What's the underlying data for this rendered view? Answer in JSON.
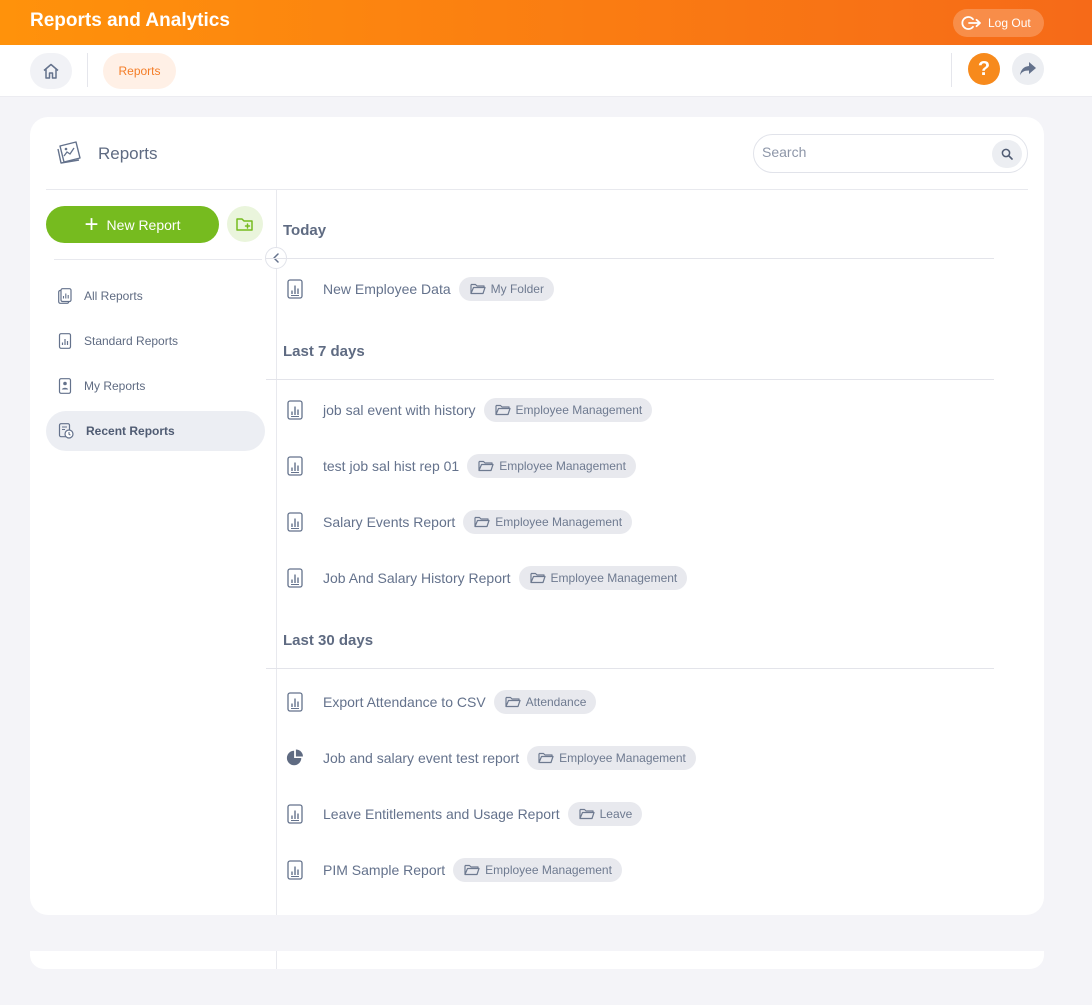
{
  "header": {
    "title": "Reports and Analytics",
    "logout_label": "Log Out"
  },
  "subnav": {
    "breadcrumb": "Reports"
  },
  "card": {
    "title": "Reports",
    "search_placeholder": "Search"
  },
  "sidebar": {
    "new_report_label": "New Report",
    "items": [
      {
        "label": "All Reports",
        "icon": "all-reports-icon"
      },
      {
        "label": "Standard Reports",
        "icon": "standard-reports-icon"
      },
      {
        "label": "My Reports",
        "icon": "my-reports-icon"
      },
      {
        "label": "Recent Reports",
        "icon": "recent-reports-icon",
        "active": true
      }
    ]
  },
  "sections": [
    {
      "title": "Today",
      "reports": [
        {
          "name": "New Employee Data",
          "folder": "My Folder",
          "icon": "report-icon"
        }
      ]
    },
    {
      "title": "Last 7 days",
      "reports": [
        {
          "name": "job sal event with history",
          "folder": "Employee Management",
          "icon": "report-icon"
        },
        {
          "name": "test job sal hist rep 01",
          "folder": "Employee Management",
          "icon": "report-icon"
        },
        {
          "name": "Salary Events Report",
          "folder": "Employee Management",
          "icon": "report-icon"
        },
        {
          "name": "Job And Salary History Report",
          "folder": "Employee Management",
          "icon": "report-icon"
        }
      ]
    },
    {
      "title": "Last 30 days",
      "reports": [
        {
          "name": "Export Attendance to CSV",
          "folder": "Attendance",
          "icon": "report-icon"
        },
        {
          "name": "Job and salary event test report",
          "folder": "Employee Management",
          "icon": "pie-chart-icon"
        },
        {
          "name": "Leave Entitlements and Usage Report",
          "folder": "Leave",
          "icon": "report-icon"
        },
        {
          "name": "PIM Sample Report",
          "folder": "Employee Management",
          "icon": "report-icon"
        }
      ]
    }
  ],
  "colors": {
    "brand_orange": "#f78a1c",
    "accent_green": "#76bb1f",
    "text": "#64728c"
  }
}
